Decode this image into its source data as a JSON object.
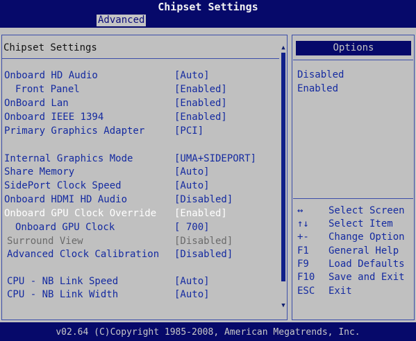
{
  "window": {
    "title": "Chipset Settings"
  },
  "tabs": [
    {
      "label": "Advanced",
      "active": true
    }
  ],
  "left_panel": {
    "heading": "Chipset Settings",
    "rows": [
      {
        "label": "Onboard HD Audio",
        "value": "[Auto]"
      },
      {
        "label": "Front Panel",
        "value": "[Enabled]"
      },
      {
        "label": "OnBoard Lan",
        "value": "[Enabled]"
      },
      {
        "label": "Onboard IEEE 1394",
        "value": "[Enabled]"
      },
      {
        "label": "Primary Graphics Adapter",
        "value": "[PCI]"
      },
      {
        "label": "Internal Graphics Mode",
        "value": "[UMA+SIDEPORT]"
      },
      {
        "label": "Share Memory",
        "value": "[Auto]"
      },
      {
        "label": "SidePort Clock Speed",
        "value": "[Auto]"
      },
      {
        "label": "Onboard HDMI HD Audio",
        "value": "[Disabled]"
      },
      {
        "label": "Onboard GPU Clock Override",
        "value": "[Enabled]",
        "selected": true
      },
      {
        "label": "Onboard GPU Clock",
        "value": "[ 700]"
      },
      {
        "label": "Surround View",
        "value": "[Disabled]",
        "disabled": true
      },
      {
        "label": "Advanced Clock Calibration",
        "value": "[Disabled]"
      },
      {
        "label": "CPU - NB Link Speed",
        "value": "[Auto]"
      },
      {
        "label": "CPU - NB Link Width",
        "value": "[Auto]"
      }
    ]
  },
  "right_panel": {
    "header": "Options",
    "options": [
      "Disabled",
      "Enabled"
    ],
    "help": [
      {
        "key": "↔",
        "desc": "Select Screen",
        "icon": "left-right-arrows-icon"
      },
      {
        "key": "↑↓",
        "desc": "Select Item",
        "icon": "up-down-arrows-icon"
      },
      {
        "key": "+-",
        "desc": "Change Option"
      },
      {
        "key": "F1",
        "desc": "General Help"
      },
      {
        "key": "F9",
        "desc": "Load Defaults"
      },
      {
        "key": "F10",
        "desc": "Save and Exit"
      },
      {
        "key": "ESC",
        "desc": "Exit"
      }
    ]
  },
  "footer": {
    "text": "v02.64 (C)Copyright 1985-2008, American Megatrends, Inc."
  },
  "colors": {
    "background_blue": "#06096a",
    "panel_gray": "#c0c0c0",
    "item_blue": "#142aa0",
    "selected_white": "#ffffff",
    "disabled_gray": "#6a6a6a"
  }
}
